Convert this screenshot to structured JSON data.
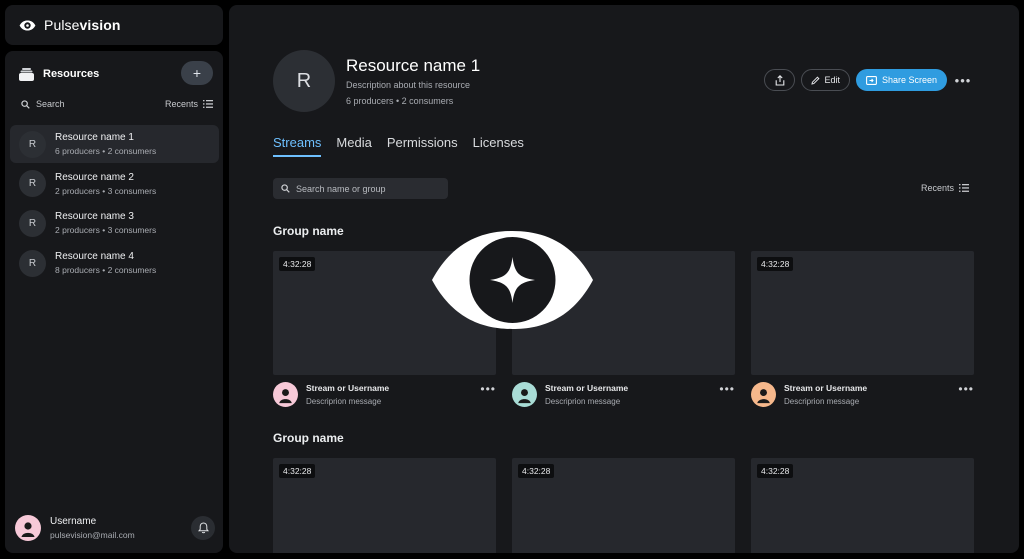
{
  "brand": {
    "prefix": "Pulse",
    "bold": "vision"
  },
  "sidebar": {
    "title": "Resources",
    "add_label": "+",
    "search_label": "Search",
    "sort_label": "Recents",
    "items": [
      {
        "initial": "R",
        "name": "Resource name 1",
        "meta": "6 producers • 2 consumers"
      },
      {
        "initial": "R",
        "name": "Resource name 2",
        "meta": "2 producers • 3 consumers"
      },
      {
        "initial": "R",
        "name": "Resource name 3",
        "meta": "2 producers • 3 consumers"
      },
      {
        "initial": "R",
        "name": "Resource name 4",
        "meta": "8 producers • 2 consumers"
      }
    ],
    "user": {
      "name": "Username",
      "email": "pulsevision@mail.com"
    }
  },
  "main": {
    "header": {
      "initial": "R",
      "title": "Resource name 1",
      "description": "Description about this resource",
      "meta": "6 producers • 2 consumers",
      "edit_label": "Edit",
      "share_label": "Share Screen"
    },
    "tabs": [
      "Streams",
      "Media",
      "Permissions",
      "Licenses"
    ],
    "search_placeholder": "Search name or group",
    "sort_label": "Recents",
    "groups": [
      {
        "title": "Group name",
        "cards": [
          {
            "duration": "4:32:28",
            "title": "Stream or Username",
            "desc": "Descriprion message",
            "avatar_color": "#f7c9d8"
          },
          {
            "duration": "4:32:28",
            "title": "Stream or Username",
            "desc": "Descriprion message",
            "avatar_color": "#a9dcd6"
          },
          {
            "duration": "4:32:28",
            "title": "Stream or Username",
            "desc": "Descriprion message",
            "avatar_color": "#f6b88c"
          }
        ]
      },
      {
        "title": "Group name",
        "cards": [
          {
            "duration": "4:32:28"
          },
          {
            "duration": "4:32:28"
          },
          {
            "duration": "4:32:28"
          }
        ]
      }
    ]
  },
  "colors": {
    "accent": "#6ec0ff",
    "primary_button": "#2f9ce0",
    "panel": "#17181b",
    "card": "#26282d"
  }
}
